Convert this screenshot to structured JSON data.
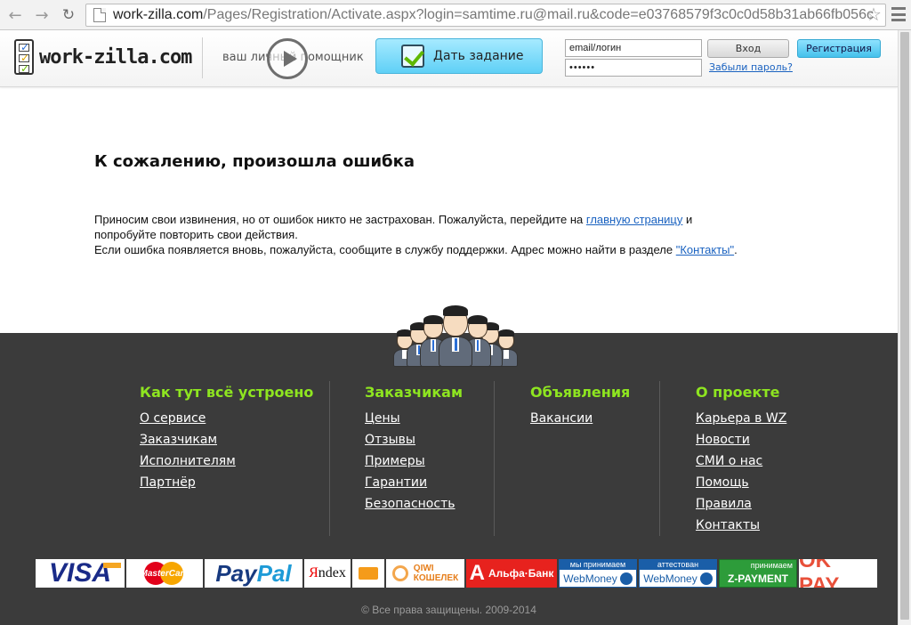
{
  "browser": {
    "url_host": "work-zilla.com",
    "url_path": "/Pages/Registration/Activate.aspx?login=samtime.ru@mail.ru&code=e03768579f3c0c0d58b31ab66fb056c"
  },
  "header": {
    "logo_text": "work-zilla.com",
    "tagline": "ваш личный помощник",
    "task_button": "Дать задание",
    "email_value": "email/логин",
    "password_value": "••••••",
    "login_button": "Вход",
    "register_button": "Регистрация",
    "forgot_link": "Забыли пароль?"
  },
  "main": {
    "title": "К сожалению, произошла ошибка",
    "line1_before": "Приносим свои извинения, но от ошибок никто не застрахован. Пожалуйста, перейдите на ",
    "line1_link": "главную страницу",
    "line1_after": " и",
    "line2": "попробуйте повторить свои действия.",
    "line3_before": "Если ошибка появляется вновь, пожалуйста, сообщите в службу поддержки. Адрес можно найти в разделе ",
    "line3_link": "\"Контакты\"",
    "line3_after": "."
  },
  "footer": {
    "columns": [
      {
        "title": "Как тут всё устроено",
        "links": [
          "О сервисе",
          "Заказчикам",
          "Исполнителям",
          "Партнёр"
        ]
      },
      {
        "title": "Заказчикам",
        "links": [
          "Цены",
          "Отзывы",
          "Примеры",
          "Гарантии",
          "Безопасность"
        ]
      },
      {
        "title": "Объявления",
        "links": [
          "Вакансии"
        ]
      },
      {
        "title": "О проекте",
        "links": [
          "Карьера в WZ",
          "Новости",
          "СМИ о нас",
          "Помощь",
          "Правила",
          "Контакты"
        ]
      }
    ],
    "payments": {
      "visa": "VISA",
      "mastercard": "MasterCard",
      "paypal_1": "Pay",
      "paypal_2": "Pal",
      "yandex_1": "Я",
      "yandex_2": "ndex",
      "qiwi_1": "QIWI",
      "qiwi_2": "КОШЕЛЕК",
      "alfa_letter": "А",
      "alfa_text": "Альфа·Банк",
      "wm1_top": "мы принимаем",
      "wm1_bot": "WebMoney",
      "wm2_top": "аттестован",
      "wm2_bot": "WebMoney",
      "zp_top": "принимаем",
      "zp_bot": "Z-PAYMENT",
      "okpay": "OK PAY"
    },
    "copyright": "© Все права защищены. 2009-2014"
  }
}
